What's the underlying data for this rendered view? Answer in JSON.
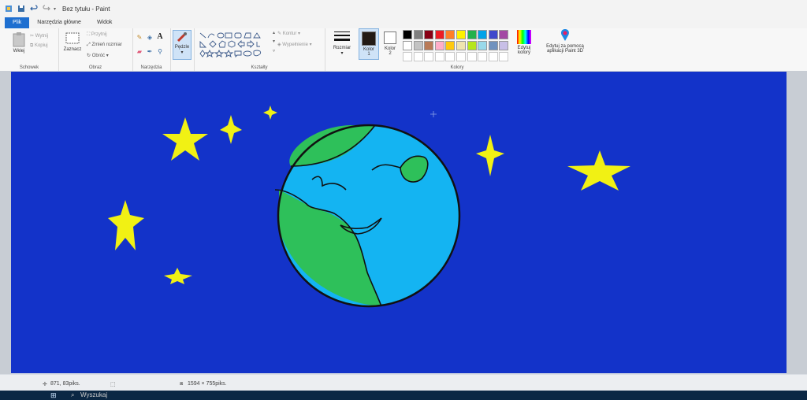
{
  "window": {
    "title": "Bez tytułu - Paint"
  },
  "tabs": [
    {
      "label": "Plik"
    },
    {
      "label": "Narzędzia główne"
    },
    {
      "label": "Widok"
    }
  ],
  "ribbon": {
    "clipboard": {
      "paste": "Wklej",
      "cut": "Wytnij",
      "copy": "Kopiuj",
      "label": "Schowek"
    },
    "image": {
      "select": "Zaznacz",
      "crop": "Przytnij",
      "resize": "Zmień rozmiar",
      "rotate": "Obróć",
      "label": "Obraz"
    },
    "tools": {
      "label": "Narzędzia",
      "text_tool": "A"
    },
    "brushes": {
      "label": "Pędzle"
    },
    "shapes": {
      "outline": "Kontur",
      "fill": "Wypełnienie",
      "label": "Kształty"
    },
    "size": {
      "label": "Rozmiar"
    },
    "color1": {
      "label": "Kolor",
      "num": "1"
    },
    "color2": {
      "label": "Kolor",
      "num": "2"
    },
    "colors_group": {
      "label": "Kolory"
    },
    "edit_colors": {
      "line1": "Edytuj",
      "line2": "kolory"
    },
    "paint3d": {
      "line1": "Edytuj za pomocą",
      "line2": "aplikacji Paint 3D"
    }
  },
  "palette": {
    "row1": [
      "#000000",
      "#7f7f7f",
      "#880015",
      "#ed1c24",
      "#ff7f27",
      "#fff200",
      "#22b14c",
      "#00a2e8",
      "#3f48cc",
      "#a349a4"
    ],
    "row2": [
      "#ffffff",
      "#c3c3c3",
      "#b97a57",
      "#ffaec9",
      "#ffc90e",
      "#efe4b0",
      "#b5e61d",
      "#99d9ea",
      "#7092be",
      "#c8bfe7"
    ],
    "row3": [
      "#ffffff",
      "#ffffff",
      "#ffffff",
      "#ffffff",
      "#ffffff",
      "#ffffff",
      "#ffffff",
      "#ffffff",
      "#ffffff",
      "#ffffff"
    ]
  },
  "colors": {
    "primary": "#221a14",
    "secondary": "#ffffff",
    "canvas_bg": "#1333c9",
    "earth_ocean": "#14b4f2",
    "earth_land": "#2ec05a",
    "star": "#f1f114"
  },
  "status": {
    "cursor": "871, 83piks.",
    "dimensions": "1594 × 755piks."
  },
  "taskbar": {
    "search": "Wyszukaj"
  }
}
